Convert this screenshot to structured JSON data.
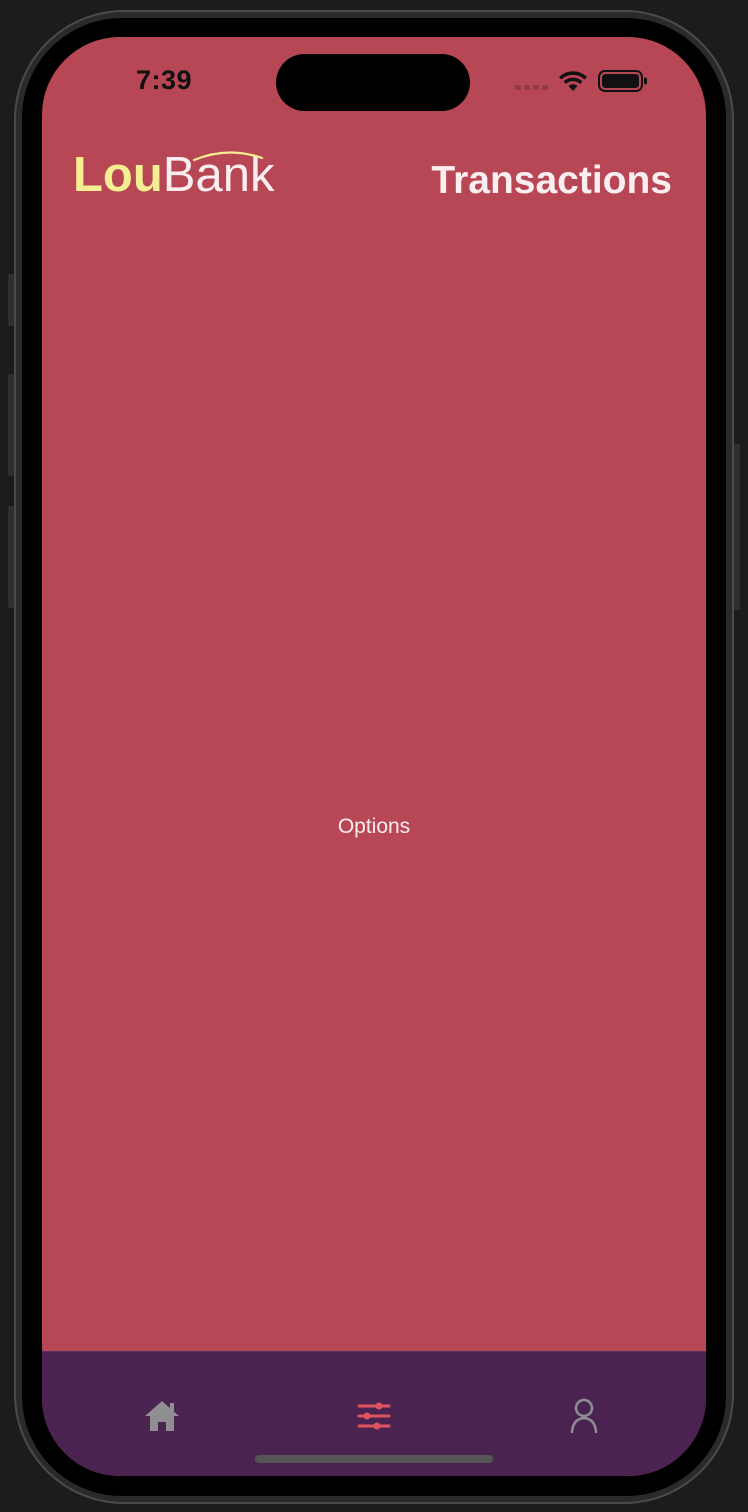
{
  "status_bar": {
    "time": "7:39"
  },
  "header": {
    "logo_primary": "Lou",
    "logo_secondary": "Bank",
    "title": "Transactions"
  },
  "main": {
    "placeholder_text": "Options"
  },
  "tab_bar": {
    "tabs": [
      {
        "icon": "home-icon",
        "selected": false
      },
      {
        "icon": "sliders-icon",
        "selected": true
      },
      {
        "icon": "person-icon",
        "selected": false
      }
    ]
  },
  "colors": {
    "background": "#b84756",
    "tab_bar": "#4a2350",
    "logo_accent": "#f5ee93",
    "selected_tab": "#e0545e",
    "unselected_tab": "#8e8e93"
  }
}
